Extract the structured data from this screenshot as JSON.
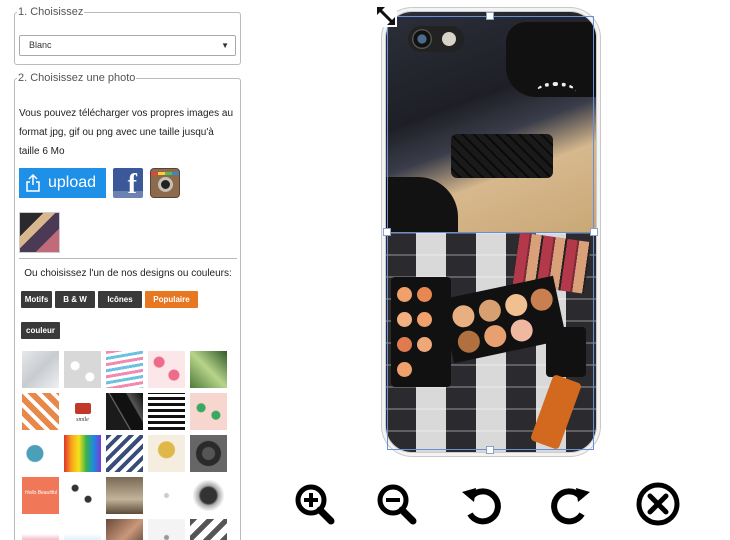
{
  "step1": {
    "legend": "1. Choisissez",
    "select_value": "Blanc"
  },
  "step2": {
    "legend": "2. Choisissez une photo",
    "description": "Vous pouvez télécharger vos propres images au format jpg, gif ou png avec une taille jusqu'à taille 6 Mo",
    "upload_label": "upload",
    "or_choose": "Ou choisissez l'un de nos designs ou couleurs:",
    "tabs": [
      {
        "label": "Motifs",
        "active": false
      },
      {
        "label": "B & W",
        "active": false
      },
      {
        "label": "Icônes",
        "active": false
      },
      {
        "label": "Populaire",
        "active": true
      },
      {
        "label": "couleur",
        "active": false
      }
    ],
    "tile_caption_camera": "smile",
    "tile_caption_hello": "Hello Beautiful"
  },
  "colors": {
    "accent_blue": "#1e90e8",
    "active_tab": "#e87722",
    "tab_default": "#3a3a3a",
    "selection_border": "#6b8fd6"
  },
  "toolbar": {
    "icons": [
      "zoom-in-icon",
      "zoom-out-icon",
      "rotate-left-icon",
      "rotate-right-icon",
      "remove-icon"
    ]
  }
}
